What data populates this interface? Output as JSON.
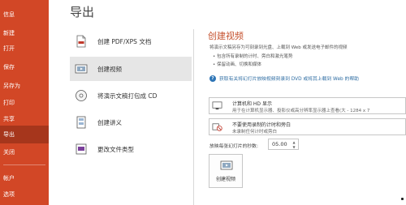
{
  "nav": {
    "items": [
      {
        "label": "信息"
      },
      {
        "label": "新建"
      },
      {
        "label": "打开"
      },
      {
        "label": "保存"
      },
      {
        "label": "另存为"
      },
      {
        "label": "打印"
      },
      {
        "label": "共享"
      },
      {
        "label": "导出"
      },
      {
        "label": "关闭"
      },
      {
        "label": "帐户"
      },
      {
        "label": "选项"
      }
    ],
    "active_label": "导出"
  },
  "page": {
    "title": "导出"
  },
  "options": [
    {
      "label": "创建 PDF/XPS 文档",
      "icon": "pdf-document-icon"
    },
    {
      "label": "创建视频",
      "icon": "video-icon"
    },
    {
      "label": "将演示文稿打包成 CD",
      "icon": "cd-icon"
    },
    {
      "label": "创建讲义",
      "icon": "handout-icon"
    },
    {
      "label": "更改文件类型",
      "icon": "file-type-icon"
    }
  ],
  "detail": {
    "title": "创建视频",
    "description": "将演示文稿另存为可刻录到光盘、上载到 Web 或发送电子邮件的视频",
    "bullets": [
      "包含所有录制的计时、旁白和激光笔势",
      "保留动画、切换和媒体"
    ],
    "help_link": "获取有关将幻灯片放映视频刻录到 DVD 或将其上载到 Web 的帮助",
    "quality": {
      "line1": "计算机和 HD 显示",
      "line2": "用于在计算机显示器、投影仪或高分辨率显示器上查看(大 - 1284 x 7"
    },
    "timings": {
      "line1": "不要使用录制的计时和旁白",
      "line2": "未录制任何计时或旁白"
    },
    "seconds_label": "放映每张幻灯片的秒数:",
    "seconds_value": "05.00",
    "create_button": "创建视频"
  }
}
